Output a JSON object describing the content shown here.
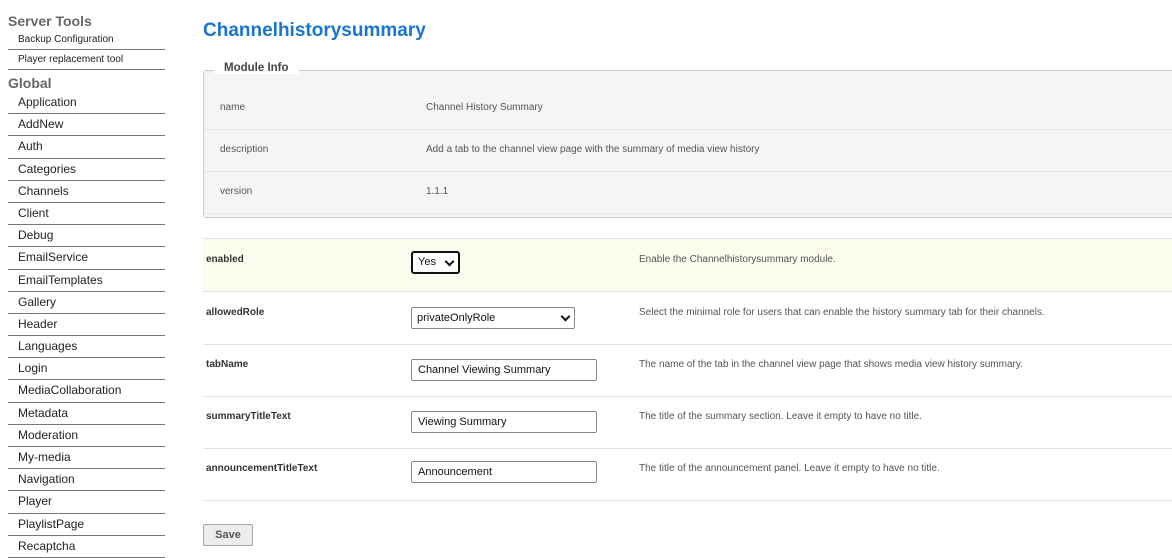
{
  "sidebar": {
    "server_tools_heading": "Server Tools",
    "server_tools": [
      "Backup Configuration",
      "Player replacement tool"
    ],
    "global_heading": "Global",
    "global_items": [
      "Application",
      "AddNew",
      "Auth",
      "Categories",
      "Channels",
      "Client",
      "Debug",
      "EmailService",
      "EmailTemplates",
      "Gallery",
      "Header",
      "Languages",
      "Login",
      "MediaCollaboration",
      "Metadata",
      "Moderation",
      "My-media",
      "Navigation",
      "Player",
      "PlaylistPage",
      "Recaptcha"
    ]
  },
  "page": {
    "title": "Channelhistorysummary"
  },
  "module_info": {
    "legend": "Module Info",
    "rows": [
      {
        "key": "name",
        "value": "Channel History Summary"
      },
      {
        "key": "description",
        "value": "Add a tab to the channel view page with the summary of media view history"
      },
      {
        "key": "version",
        "value": "1.1.1"
      }
    ]
  },
  "config": {
    "enabled": {
      "label": "enabled",
      "value": "Yes",
      "description": "Enable the Channelhistorysummary module."
    },
    "allowedRole": {
      "label": "allowedRole",
      "value": "privateOnlyRole",
      "description": "Select the minimal role for users that can enable the history summary tab for their channels."
    },
    "tabName": {
      "label": "tabName",
      "value": "Channel Viewing Summary",
      "description": "The name of the tab in the channel view page that shows media view history summary."
    },
    "summaryTitleText": {
      "label": "summaryTitleText",
      "value": "Viewing Summary",
      "description": "The title of the summary section. Leave it empty to have no title."
    },
    "announcementTitleText": {
      "label": "announcementTitleText",
      "value": "Announcement",
      "description": "The title of the announcement panel. Leave it empty to have no title."
    }
  },
  "actions": {
    "save_label": "Save"
  },
  "colors": {
    "title": "#1a75d0",
    "highlight_row": "#fcfcee"
  }
}
